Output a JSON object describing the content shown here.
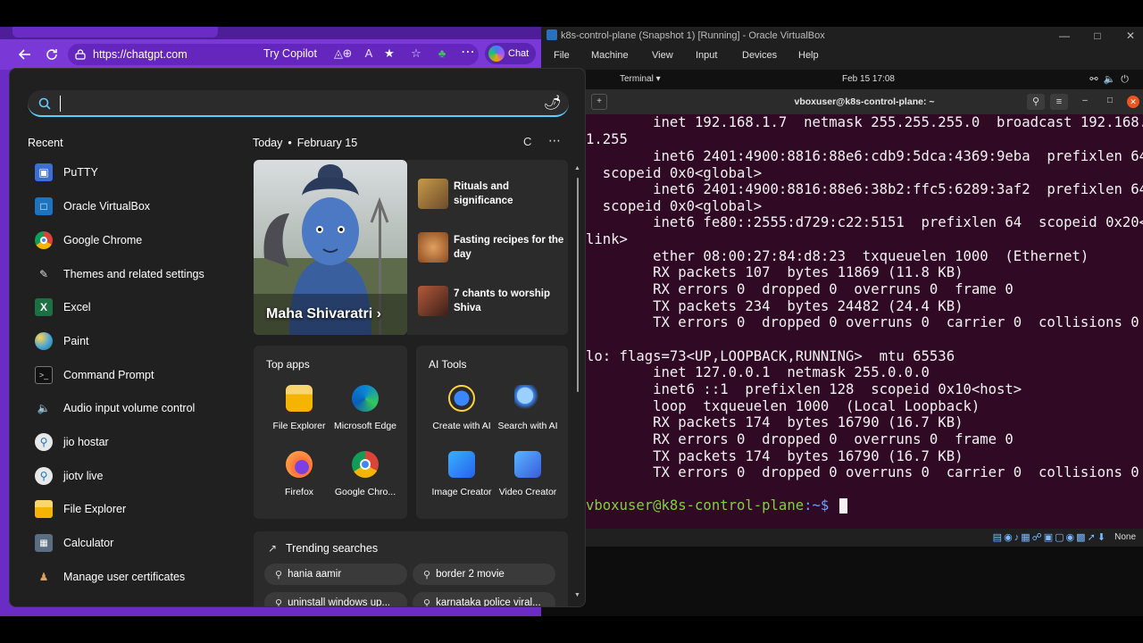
{
  "browser": {
    "url": "https://chatgpt.com",
    "try_copilot": "Try Copilot",
    "chat_label": "Chat"
  },
  "vbox": {
    "title": "k8s-control-plane (Snapshot 1) [Running] - Oracle VirtualBox",
    "menus": [
      "File",
      "Machine",
      "View",
      "Input",
      "Devices",
      "Help"
    ],
    "status_text": "None"
  },
  "guest": {
    "app_label": "Terminal",
    "clock": "Feb 15  17:08",
    "terminal_title": "vboxuser@k8s-control-plane: ~",
    "lines": [
      "        inet 192.168.1.7  netmask 255.255.255.0  broadcast 192.168.",
      "1.255",
      "        inet6 2401:4900:8816:88e6:cdb9:5dca:4369:9eba  prefixlen 64",
      "  scopeid 0x0<global>",
      "        inet6 2401:4900:8816:88e6:38b2:ffc5:6289:3af2  prefixlen 64",
      "  scopeid 0x0<global>",
      "        inet6 fe80::2555:d729:c22:5151  prefixlen 64  scopeid 0x20<",
      "link>",
      "        ether 08:00:27:84:d8:23  txqueuelen 1000  (Ethernet)",
      "        RX packets 107  bytes 11869 (11.8 KB)",
      "        RX errors 0  dropped 0  overruns 0  frame 0",
      "        TX packets 234  bytes 24482 (24.4 KB)",
      "        TX errors 0  dropped 0 overruns 0  carrier 0  collisions 0",
      "",
      "lo: flags=73<UP,LOOPBACK,RUNNING>  mtu 65536",
      "        inet 127.0.0.1  netmask 255.0.0.0",
      "        inet6 ::1  prefixlen 128  scopeid 0x10<host>",
      "        loop  txqueuelen 1000  (Local Loopback)",
      "        RX packets 174  bytes 16790 (16.7 KB)",
      "        RX errors 0  dropped 0  overruns 0  frame 0",
      "        TX packets 174  bytes 16790 (16.7 KB)",
      "        TX errors 0  dropped 0 overruns 0  carrier 0  collisions 0",
      ""
    ],
    "prompt_user": "vboxuser@k8s-control-plane",
    "prompt_path": ":~$"
  },
  "search": {
    "placeholder": "",
    "recent_heading": "Recent",
    "recent": [
      {
        "label": "PuTTY",
        "icon": "putty-icon",
        "color": "#3b6fd1"
      },
      {
        "label": "Oracle VirtualBox",
        "icon": "virtualbox-icon",
        "color": "#1e73be"
      },
      {
        "label": "Google Chrome",
        "icon": "chrome-icon",
        "color": "#db4437"
      },
      {
        "label": "Themes and related settings",
        "icon": "brush-icon",
        "color": "#cccccc"
      },
      {
        "label": "Excel",
        "icon": "excel-icon",
        "color": "#1d7044"
      },
      {
        "label": "Paint",
        "icon": "paint-icon",
        "color": "#3fa0e0"
      },
      {
        "label": "Command Prompt",
        "icon": "cmd-icon",
        "color": "#444444"
      },
      {
        "label": "Audio input volume control",
        "icon": "speaker-icon",
        "color": "#cccccc"
      },
      {
        "label": "jio hostar",
        "icon": "web-search-icon",
        "color": "#e8e8e8"
      },
      {
        "label": "jiotv live",
        "icon": "web-search-icon",
        "color": "#e8e8e8"
      },
      {
        "label": "File Explorer",
        "icon": "folder-icon",
        "color": "#f4c430"
      },
      {
        "label": "Calculator",
        "icon": "calculator-icon",
        "color": "#5b6d80"
      },
      {
        "label": "Manage user certificates",
        "icon": "certificates-icon",
        "color": "#c08040"
      }
    ],
    "today_label": "Today",
    "today_date": "February 15",
    "hero_title": "Maha Shivaratri",
    "stories": [
      {
        "title": "Rituals and significance"
      },
      {
        "title": "Fasting recipes for the day"
      },
      {
        "title": "7 chants to worship Shiva"
      }
    ],
    "top_apps_title": "Top apps",
    "top_apps": [
      {
        "label": "File Explorer",
        "icon": "folder-icon"
      },
      {
        "label": "Microsoft Edge",
        "icon": "edge-icon"
      },
      {
        "label": "Firefox",
        "icon": "firefox-icon"
      },
      {
        "label": "Google Chro...",
        "icon": "chrome-icon"
      }
    ],
    "ai_tools_title": "AI Tools",
    "ai_tools": [
      {
        "label": "Create with AI",
        "icon": "create-ai-icon"
      },
      {
        "label": "Search with AI",
        "icon": "search-ai-icon"
      },
      {
        "label": "Image Creator",
        "icon": "image-creator-icon"
      },
      {
        "label": "Video Creator",
        "icon": "video-creator-icon"
      }
    ],
    "trending_title": "Trending searches",
    "trending": [
      "hania aamir",
      "border 2 movie",
      "uninstall windows up...",
      "karnataka police viral..."
    ]
  }
}
